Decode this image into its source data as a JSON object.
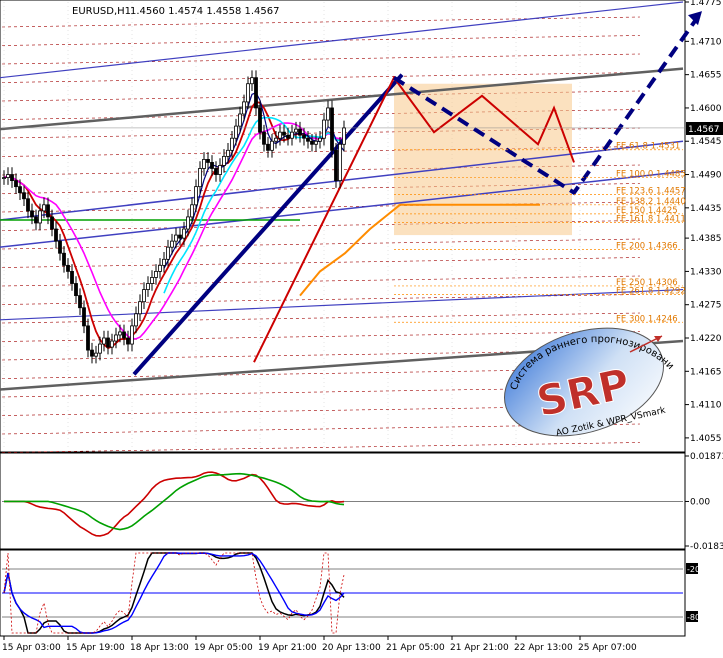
{
  "header": {
    "symbol": "EURUSD,H1",
    "ohlc": "1.4560 1.4574 1.4558 1.4567"
  },
  "colors": {
    "background": "#ffffff",
    "grid": "#c8c8c8",
    "axis": "#000000",
    "candle": "#000000",
    "trend_dark": "#000080",
    "sma_red": "#cc0000",
    "ma_magenta": "#ff00ff",
    "ma_cyan": "#00e5ff",
    "ma_green": "#00a000",
    "level_orange": "#ff8c00",
    "fib_box": "#f7c98a",
    "price_box_bg": "#000000",
    "price_box_fg": "#ffffff",
    "channel_blue": "#4040c0",
    "channel_grey": "#606060",
    "dotted_red": "#a00000",
    "fe_label": "#e07800"
  },
  "chart_data": [
    {
      "type": "candlestick",
      "title": "",
      "ylim": [
        1.4035,
        1.4775
      ],
      "y_ticks": [
        "1.4775",
        "1.4710",
        "1.4655",
        "1.4600",
        "1.4545",
        "1.4490",
        "1.4435",
        "1.4385",
        "1.4330",
        "1.4275",
        "1.4220",
        "1.4165",
        "1.4110",
        "1.4055"
      ],
      "x_ticks": [
        "15 Apr 03:00",
        "15 Apr 19:00",
        "18 Apr 13:00",
        "19 Apr 05:00",
        "19 Apr 21:00",
        "20 Apr 13:00",
        "21 Apr 05:00",
        "21 Apr 21:00",
        "22 Apr 13:00",
        "25 Apr 07:00"
      ],
      "current_price": "1.4567",
      "current_price_value": 1.4567,
      "close_series": [
        1.4485,
        1.449,
        1.448,
        1.447,
        1.446,
        1.445,
        1.443,
        1.442,
        1.441,
        1.443,
        1.444,
        1.442,
        1.44,
        1.438,
        1.436,
        1.434,
        1.433,
        1.431,
        1.429,
        1.427,
        1.424,
        1.42,
        1.419,
        1.4195,
        1.421,
        1.422,
        1.4205,
        1.4215,
        1.4225,
        1.423,
        1.422,
        1.421,
        1.424,
        1.426,
        1.428,
        1.43,
        1.431,
        1.432,
        1.433,
        1.434,
        1.435,
        1.437,
        1.438,
        1.439,
        1.4385,
        1.44,
        1.442,
        1.444,
        1.447,
        1.45,
        1.4515,
        1.451,
        1.45,
        1.449,
        1.4505,
        1.452,
        1.453,
        1.455,
        1.457,
        1.459,
        1.461,
        1.464,
        1.465,
        1.46,
        1.456,
        1.454,
        1.453,
        1.4545,
        1.455,
        1.456,
        1.4555,
        1.455,
        1.456,
        1.4565,
        1.4555,
        1.455,
        1.4545,
        1.454,
        1.4545,
        1.455,
        1.458,
        1.46,
        1.453,
        1.448,
        1.454,
        1.4567
      ],
      "fib_levels": [
        {
          "label": "FE 61.8",
          "value": "1.4531"
        },
        {
          "label": "FE 100.0",
          "value": "1.4485"
        },
        {
          "label": "FE 123.6",
          "value": "1.4457"
        },
        {
          "label": "FE 138.2",
          "value": "1.4440"
        },
        {
          "label": "FE 150",
          "value": "1.4425"
        },
        {
          "label": "FE 161.8",
          "value": "1.4411"
        },
        {
          "label": "FE 200",
          "value": "1.4366"
        },
        {
          "label": "FE 250",
          "value": "1.4306"
        },
        {
          "label": "FE 261.8",
          "value": "1.4292"
        },
        {
          "label": "FE 300",
          "value": "1.4246"
        }
      ],
      "zigzag": [
        [
          63,
          1.418
        ],
        [
          98,
          1.465
        ],
        [
          108,
          1.456
        ],
        [
          120,
          1.462
        ],
        [
          134,
          1.454
        ],
        [
          138,
          1.46
        ],
        [
          143,
          1.451
        ]
      ],
      "projection": [
        [
          98,
          1.465
        ],
        [
          143,
          1.446
        ],
        [
          175,
          1.476
        ]
      ],
      "grid": true,
      "legend": "none"
    },
    {
      "type": "line",
      "name": "oscillator-1",
      "ylim": [
        -0.01835,
        0.01873
      ],
      "y_ticks": [
        "0.01873",
        "0.00",
        "-0.01835"
      ]
    },
    {
      "type": "line",
      "name": "oscillator-2",
      "ylim": [
        -100,
        0
      ],
      "y_ticks": [
        "-20",
        "-80"
      ]
    }
  ],
  "watermark": {
    "logo": "SRP",
    "ring_text": "Система раннего прогнозирования",
    "credit": "AO Zotik & WPR_VSmark"
  }
}
